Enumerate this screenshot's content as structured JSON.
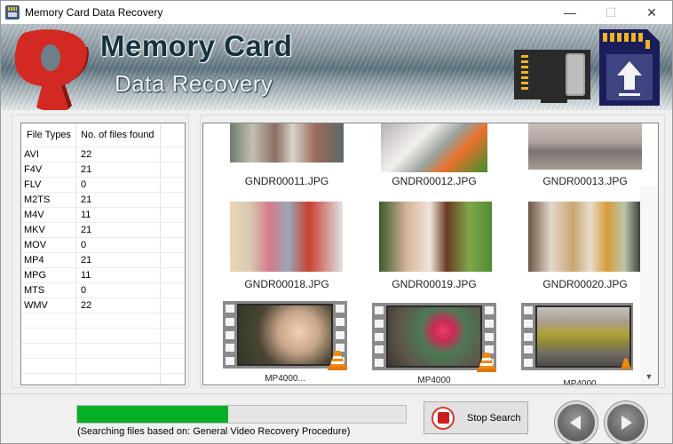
{
  "window": {
    "title": "Memory Card Data Recovery",
    "controls": {
      "minimize": "—",
      "maximize": "☐",
      "close": "✕"
    }
  },
  "banner": {
    "title_line1": "Memory Card",
    "title_line2": "Data Recovery",
    "colors": {
      "logo": "#d22a22",
      "title_dark": "#14333f"
    }
  },
  "file_types_table": {
    "headers": [
      "File Types",
      "No. of files found"
    ],
    "rows": [
      {
        "type": "AVI",
        "count": "22"
      },
      {
        "type": "F4V",
        "count": "21"
      },
      {
        "type": "FLV",
        "count": "0"
      },
      {
        "type": "M2TS",
        "count": "21"
      },
      {
        "type": "M4V",
        "count": "11"
      },
      {
        "type": "MKV",
        "count": "21"
      },
      {
        "type": "MOV",
        "count": "0"
      },
      {
        "type": "MP4",
        "count": "21"
      },
      {
        "type": "MPG",
        "count": "11"
      },
      {
        "type": "MTS",
        "count": "0"
      },
      {
        "type": "WMV",
        "count": "22"
      }
    ]
  },
  "thumbnails": [
    {
      "name": "GNDR00011.JPG",
      "kind": "photo",
      "subject": "group at table"
    },
    {
      "name": "GNDR00012.JPG",
      "kind": "photo",
      "subject": "writing on paper"
    },
    {
      "name": "GNDR00013.JPG",
      "kind": "photo",
      "subject": "people sitting on bench"
    },
    {
      "name": "GNDR00018.JPG",
      "kind": "photo",
      "subject": "family conversation"
    },
    {
      "name": "GNDR00019.JPG",
      "kind": "photo",
      "subject": "smiling couple"
    },
    {
      "name": "GNDR00020.JPG",
      "kind": "photo",
      "subject": "friends at cafe"
    },
    {
      "name": "MP4000...",
      "kind": "video",
      "subject": "flowers"
    },
    {
      "name": "MP4000",
      "kind": "video",
      "subject": "pink flower"
    },
    {
      "name": "MP4000",
      "kind": "video",
      "subject": "city street"
    }
  ],
  "progress": {
    "percent": 46,
    "color": "#06b025",
    "status": "(Searching files based on:  General Video Recovery Procedure)"
  },
  "buttons": {
    "stop_search": "Stop Search",
    "back_icon": "arrow-left-icon",
    "next_icon": "arrow-right-icon"
  }
}
